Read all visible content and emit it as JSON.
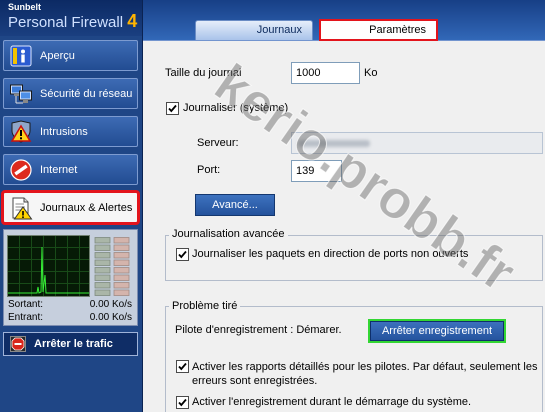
{
  "app": {
    "brand": "Sunbelt",
    "product": "Personal Firewall",
    "version": "4"
  },
  "colors": {
    "annot-red": "#e3141c",
    "annot-green": "#33d633",
    "sidebar-bg": "#1f4686",
    "button-blue": "#2d5fab"
  },
  "tabs": [
    {
      "label": "Journaux",
      "selected": false
    },
    {
      "label": "Paramètres",
      "selected": true
    }
  ],
  "sidebar": {
    "items": [
      {
        "label": "Aperçu",
        "icon": "info-icon",
        "selected": false
      },
      {
        "label": "Sécurité du réseau",
        "icon": "network-icon",
        "selected": false
      },
      {
        "label": "Intrusions",
        "icon": "shield-warning-icon",
        "selected": false
      },
      {
        "label": "Internet",
        "icon": "no-entry-icon",
        "selected": false
      },
      {
        "label": "Journaux & Alertes",
        "icon": "log-alert-icon",
        "selected": true
      }
    ],
    "traffic": {
      "outgoing_label": "Sortant:",
      "outgoing_value": "0.00 Ko/s",
      "incoming_label": "Entrant:",
      "incoming_value": "0.00 Ko/s"
    },
    "stop_traffic": {
      "label": "Arrêter le trafic",
      "icon": "stop-icon"
    }
  },
  "settings": {
    "log_size": {
      "label": "Taille du journal",
      "value": "1000",
      "unit": "Ko"
    },
    "syslog": {
      "label": "Journaliser (système)",
      "checked": true
    },
    "server": {
      "label": "Serveur:"
    },
    "port": {
      "label": "Port:",
      "value": "139"
    },
    "advanced_button": "Avancé..."
  },
  "advanced_logging": {
    "title": "Journalisation avancée",
    "closed_ports": {
      "label": "Journaliser les paquets en direction de ports non ouverts",
      "checked": true
    }
  },
  "troubleshooting": {
    "title": "Problème tiré",
    "driver_status": "Pilote d'enregistrement : Démarer.",
    "stop_logging_button": "Arrêter enregistrement",
    "verbose_drivers": {
      "label": "Activer les rapports détaillés pour les pilotes. Par défaut, seulement les erreurs sont enregistrées.",
      "checked": true
    },
    "boot_logging": {
      "label": "Activer l'enregistrement durant le démarrage du système.",
      "checked": true
    }
  },
  "watermark": "kerio.probb.fr"
}
